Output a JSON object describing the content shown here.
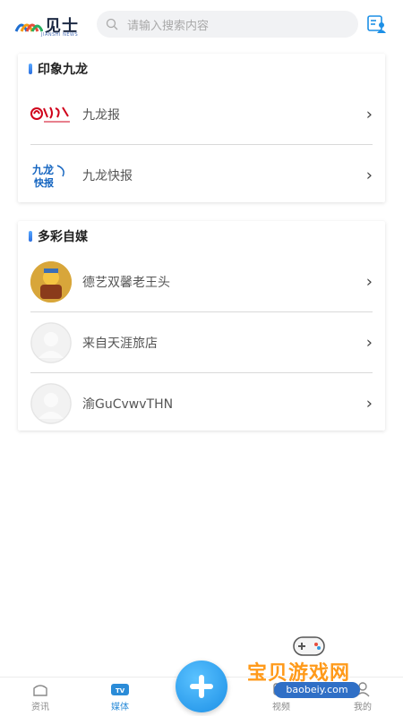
{
  "header": {
    "logo_text": "见士",
    "logo_sub": "JIANSHI NEWS",
    "search_placeholder": "请输入搜索内容"
  },
  "sections": [
    {
      "title": "印象九龙",
      "items": [
        {
          "label": "九龙报",
          "logo": "九龙报-logo"
        },
        {
          "label": "九龙快报",
          "logo": "九龙快报-logo"
        }
      ]
    },
    {
      "title": "多彩自媒",
      "items": [
        {
          "label": "德艺双馨老王头"
        },
        {
          "label": "来自天涯旅店"
        },
        {
          "label": "渝GuCvwvTHN"
        }
      ]
    }
  ],
  "tabbar": {
    "tabs": [
      {
        "label": "资讯",
        "active": false
      },
      {
        "label": "媒体",
        "active": true
      },
      {
        "label": "视频",
        "active": false
      },
      {
        "label": "我的",
        "active": false
      }
    ]
  },
  "watermark": {
    "title": "宝贝游戏网",
    "url": "baobeiy.com"
  },
  "colors": {
    "accent": "#2b8cd8",
    "fab": "#1c8fe6",
    "watermark": "#ff9a1a"
  }
}
